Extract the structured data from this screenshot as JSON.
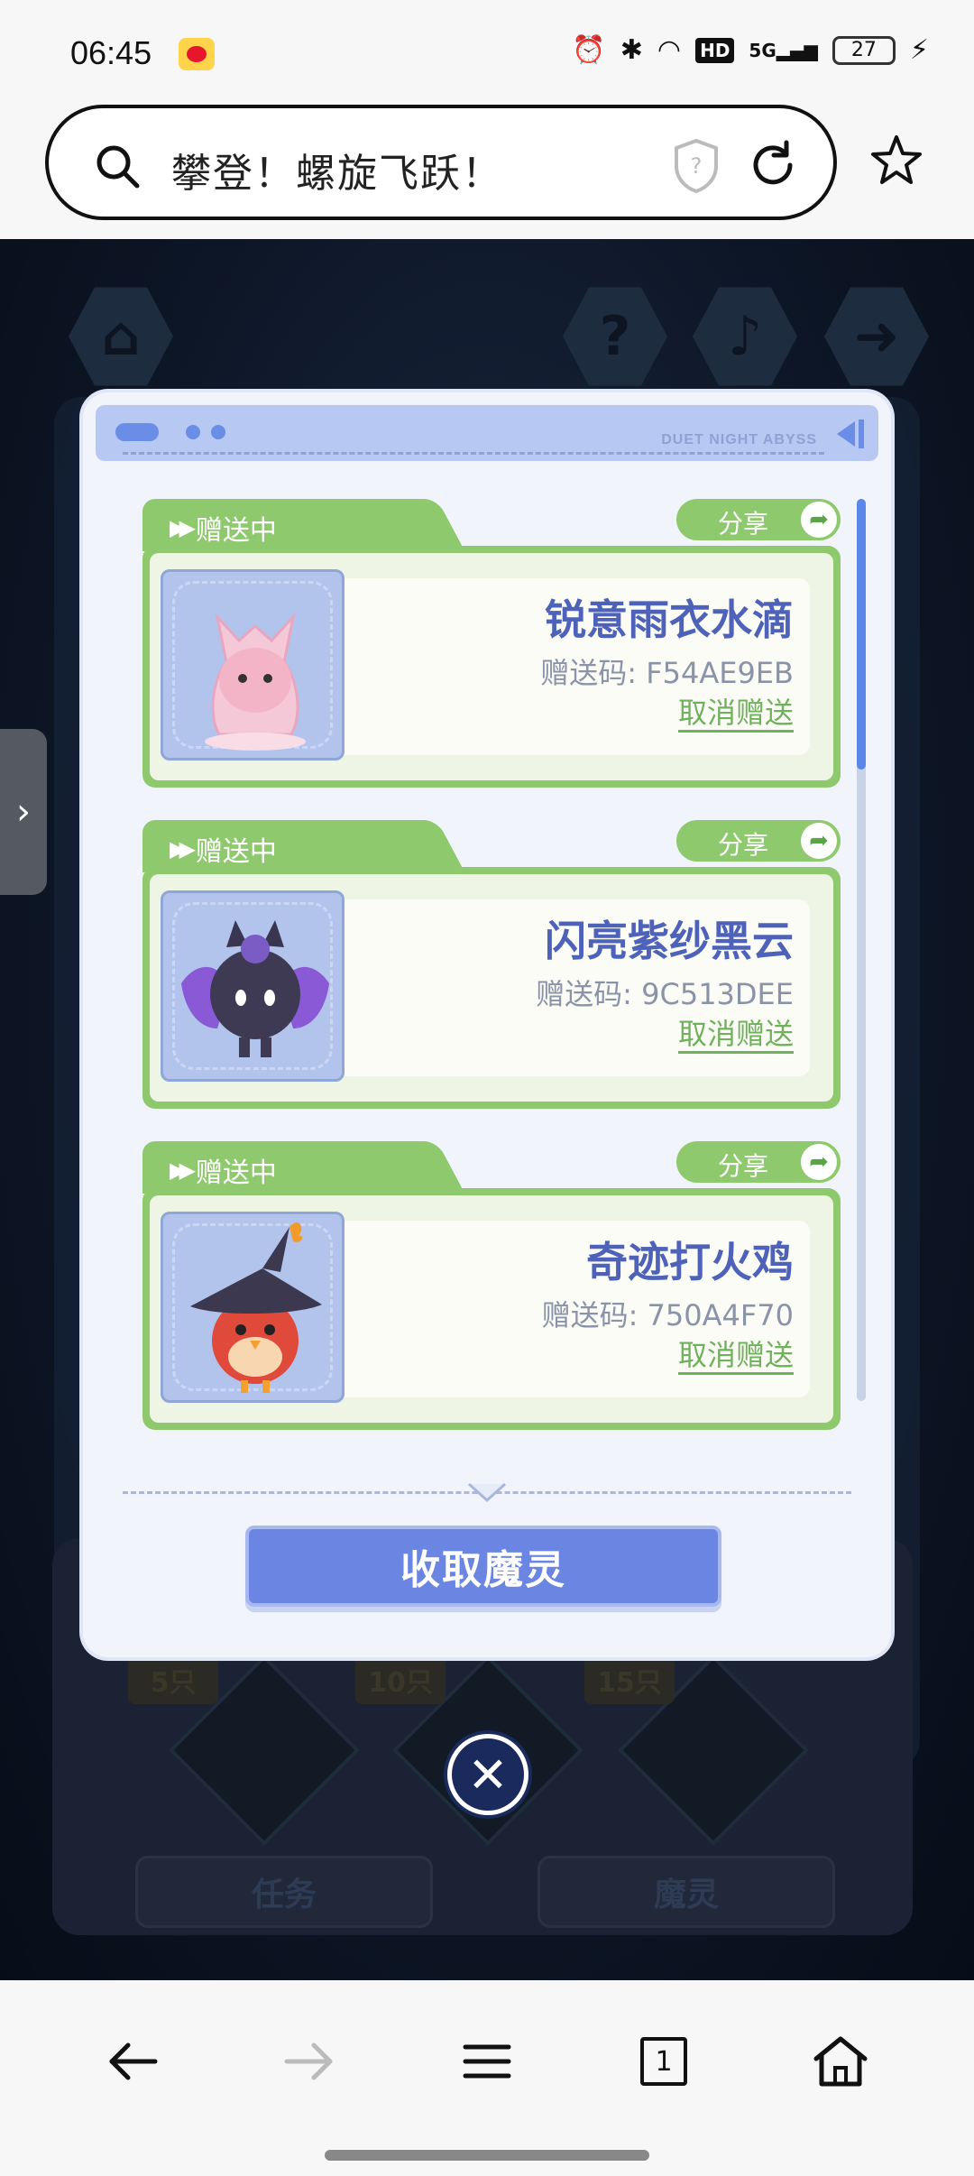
{
  "status_bar": {
    "time": "06:45",
    "battery": "27",
    "hd": "HD",
    "network": "5G"
  },
  "browser": {
    "url_text": "攀登！螺旋飞跃！",
    "tab_count": "1"
  },
  "modal": {
    "brand": "DUET NIGHT ABYSS",
    "gifts": [
      {
        "status": "赠送中",
        "share": "分享",
        "name": "锐意雨衣水滴",
        "code": "赠送码: F54AE9EB",
        "cancel": "取消赠送"
      },
      {
        "status": "赠送中",
        "share": "分享",
        "name": "闪亮紫纱黑云",
        "code": "赠送码: 9C513DEE",
        "cancel": "取消赠送"
      },
      {
        "status": "赠送中",
        "share": "分享",
        "name": "奇迹打火鸡",
        "code": "赠送码: 750A4F70",
        "cancel": "取消赠送"
      }
    ],
    "collect_button": "收取魔灵"
  },
  "background": {
    "counts": [
      "5只",
      "10只",
      "15只"
    ],
    "tabs": [
      "任务",
      "魔灵"
    ]
  },
  "colors": {
    "accent_green": "#8ec96e",
    "accent_blue": "#6a85e2",
    "name_blue": "#4d62b8"
  }
}
